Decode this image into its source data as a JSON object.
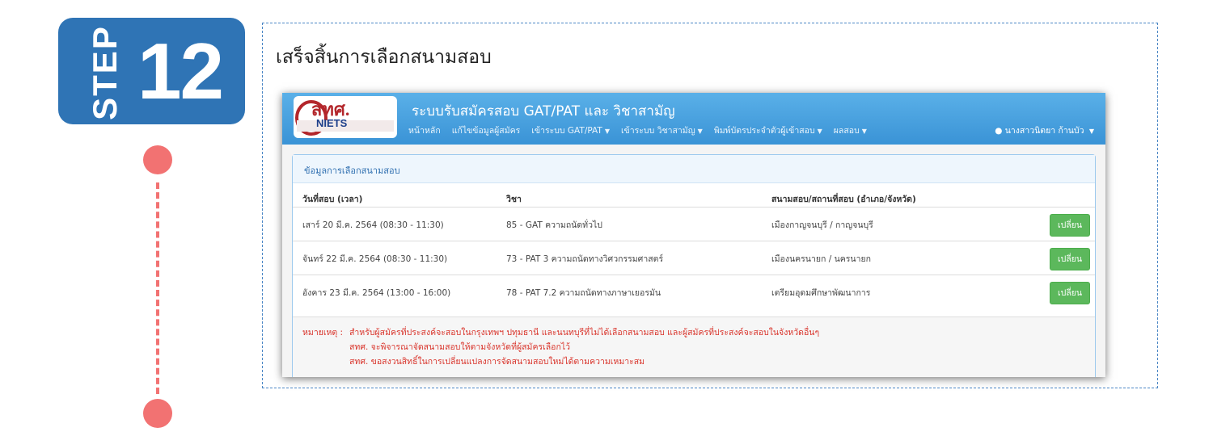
{
  "step": {
    "word": "STEP",
    "number": "12"
  },
  "heading": "เสร็จสิ้นการเลือกสนามสอบ",
  "app": {
    "logo_text": "สทศ.",
    "logo_sub": "NIETS",
    "title": "ระบบรับสมัครสอบ GAT/PAT และ วิชาสามัญ",
    "nav": [
      {
        "label": "หน้าหลัก",
        "has_caret": false
      },
      {
        "label": "แก้ไขข้อมูลผู้สมัคร",
        "has_caret": false
      },
      {
        "label": "เข้าระบบ GAT/PAT",
        "has_caret": true
      },
      {
        "label": "เข้าระบบ วิชาสามัญ",
        "has_caret": true
      },
      {
        "label": "พิมพ์บัตรประจำตัวผู้เข้าสอบ",
        "has_caret": true
      },
      {
        "label": "ผลสอบ",
        "has_caret": true
      }
    ],
    "user": "นางสาวนิตยา ก้านบัว",
    "accent": "#3a93d6"
  },
  "panel": {
    "title": "ข้อมูลการเลือกสนามสอบ",
    "columns": [
      "วันที่สอบ (เวลา)",
      "วิชา",
      "สนามสอบ/สถานที่สอบ (อำเภอ/จังหวัด)"
    ],
    "rows": [
      {
        "date": "เสาร์ 20 มี.ค. 2564   (08:30 - 11:30)",
        "subject": "85 - GAT ความถนัดทั่วไป",
        "venue": "เมืองกาญจนบุรี  /  กาญจนบุรี",
        "action": "เปลี่ยน"
      },
      {
        "date": "จันทร์ 22 มี.ค. 2564   (08:30 - 11:30)",
        "subject": "73 - PAT 3 ความถนัดทางวิศวกรรมศาสตร์",
        "venue": "เมืองนครนายก  /  นครนายก",
        "action": "เปลี่ยน"
      },
      {
        "date": "อังคาร 23 มี.ค. 2564   (13:00 - 16:00)",
        "subject": "78 - PAT 7.2 ความถนัดทางภาษาเยอรมัน",
        "venue": "เตรียมอุดมศึกษาพัฒนาการ",
        "action": "เปลี่ยน"
      }
    ],
    "note_label": "หมายเหตุ :",
    "notes": [
      "สำหรับผู้สมัครที่ประสงค์จะสอบในกรุงเทพฯ ปทุมธานี และนนทบุรีที่ไม่ได้เลือกสนามสอบ และผู้สมัครที่ประสงค์จะสอบในจังหวัดอื่นๆ",
      "สทศ. จะพิจารณาจัดสนามสอบให้ตามจังหวัดที่ผู้สมัครเลือกไว้",
      "สทศ. ขอสงวนสิทธิ์ในการเปลี่ยนแปลงการจัดสนามสอบใหม่ได้ตามความเหมาะสม"
    ]
  }
}
